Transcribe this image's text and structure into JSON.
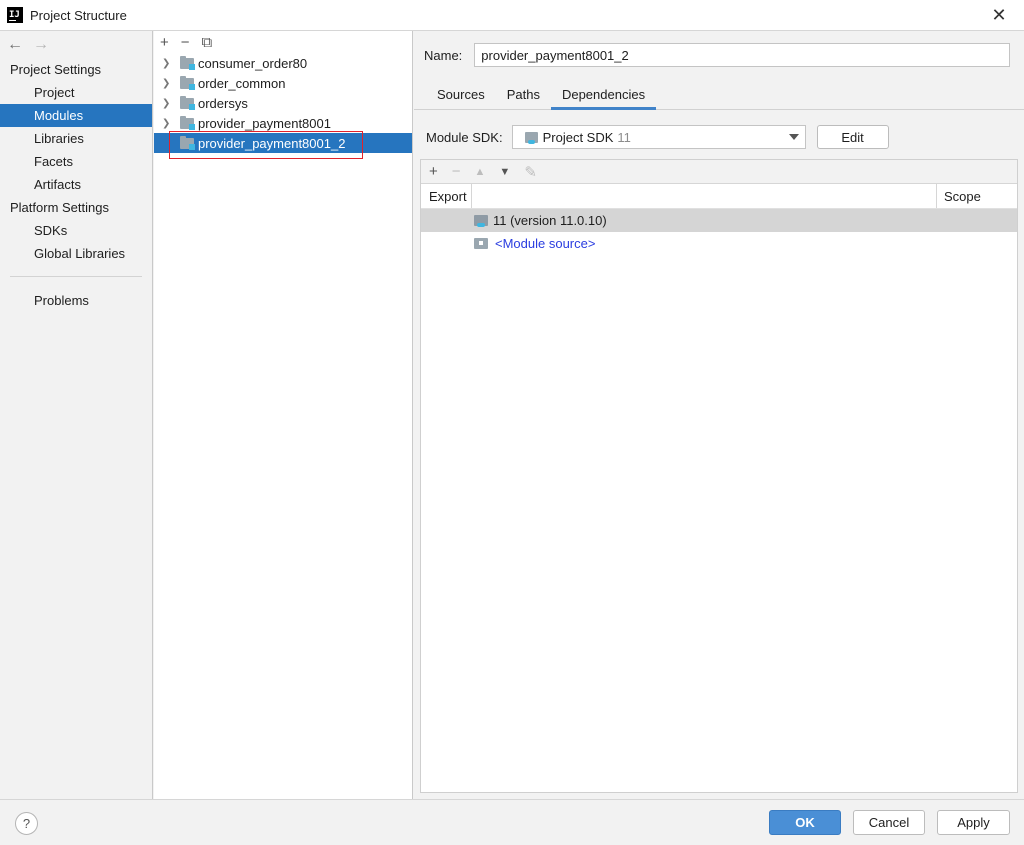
{
  "window": {
    "title": "Project Structure",
    "logo_text": "IJ"
  },
  "nav": {
    "back_arrow": "←",
    "forward_arrow": "→",
    "project_settings_header": "Project Settings",
    "project_settings_items": [
      "Project",
      "Modules",
      "Libraries",
      "Facets",
      "Artifacts"
    ],
    "platform_settings_header": "Platform Settings",
    "platform_settings_items": [
      "SDKs",
      "Global Libraries"
    ],
    "problems": "Problems",
    "selected": "Modules"
  },
  "module_tree": {
    "toolbar": [
      "+",
      "−",
      "⧉"
    ],
    "modules": [
      {
        "name": "consumer_order80",
        "expandable": true
      },
      {
        "name": "order_common",
        "expandable": true
      },
      {
        "name": "ordersys",
        "expandable": true
      },
      {
        "name": "provider_payment8001",
        "expandable": true
      },
      {
        "name": "provider_payment8001_2",
        "expandable": false,
        "selected": true
      }
    ]
  },
  "details": {
    "name_label": "Name:",
    "name_value": "provider_payment8001_2",
    "tabs": [
      "Sources",
      "Paths",
      "Dependencies"
    ],
    "active_tab": "Dependencies",
    "module_sdk_label": "Module SDK:",
    "module_sdk_value": "Project SDK",
    "module_sdk_version": "11",
    "edit_label": "Edit",
    "dep_toolbar": [
      "+",
      "−",
      "▲",
      "▼",
      "✎"
    ],
    "columns": {
      "export": "Export",
      "scope": "Scope"
    },
    "dependencies": [
      {
        "label": "11 (version 11.0.10)",
        "type": "jdk",
        "selected": true
      },
      {
        "label": "<Module source>",
        "type": "module-source",
        "selected": false
      }
    ]
  },
  "footer": {
    "help": "?",
    "ok": "OK",
    "cancel": "Cancel",
    "apply": "Apply"
  },
  "colors": {
    "selection": "#2675bf",
    "ok_button": "#4a8fd6",
    "highlight_box": "#e0222a",
    "link": "#2a3de0"
  }
}
